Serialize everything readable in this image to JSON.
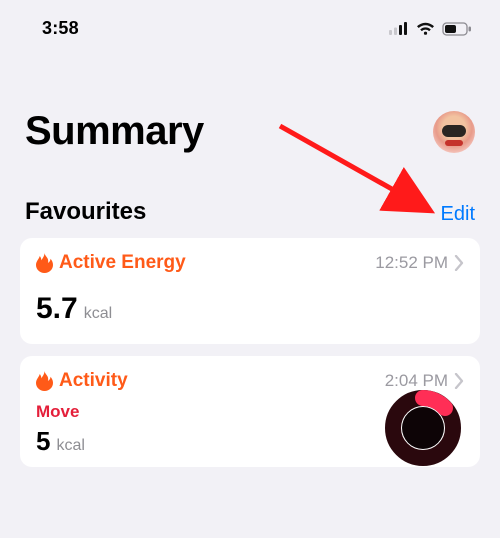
{
  "status_bar": {
    "time": "3:58"
  },
  "page_title": "Summary",
  "section": {
    "title": "Favourites",
    "edit_label": "Edit"
  },
  "cards": {
    "active_energy": {
      "title": "Active Energy",
      "timestamp": "12:52 PM",
      "value": "5.7",
      "unit": "kcal"
    },
    "activity": {
      "title": "Activity",
      "timestamp": "2:04 PM",
      "sub_label": "Move",
      "value": "5",
      "unit": "kcal"
    }
  },
  "colors": {
    "accent_orange": "#ff5a18",
    "link_blue": "#007aff",
    "move_red": "#e41f3a"
  }
}
